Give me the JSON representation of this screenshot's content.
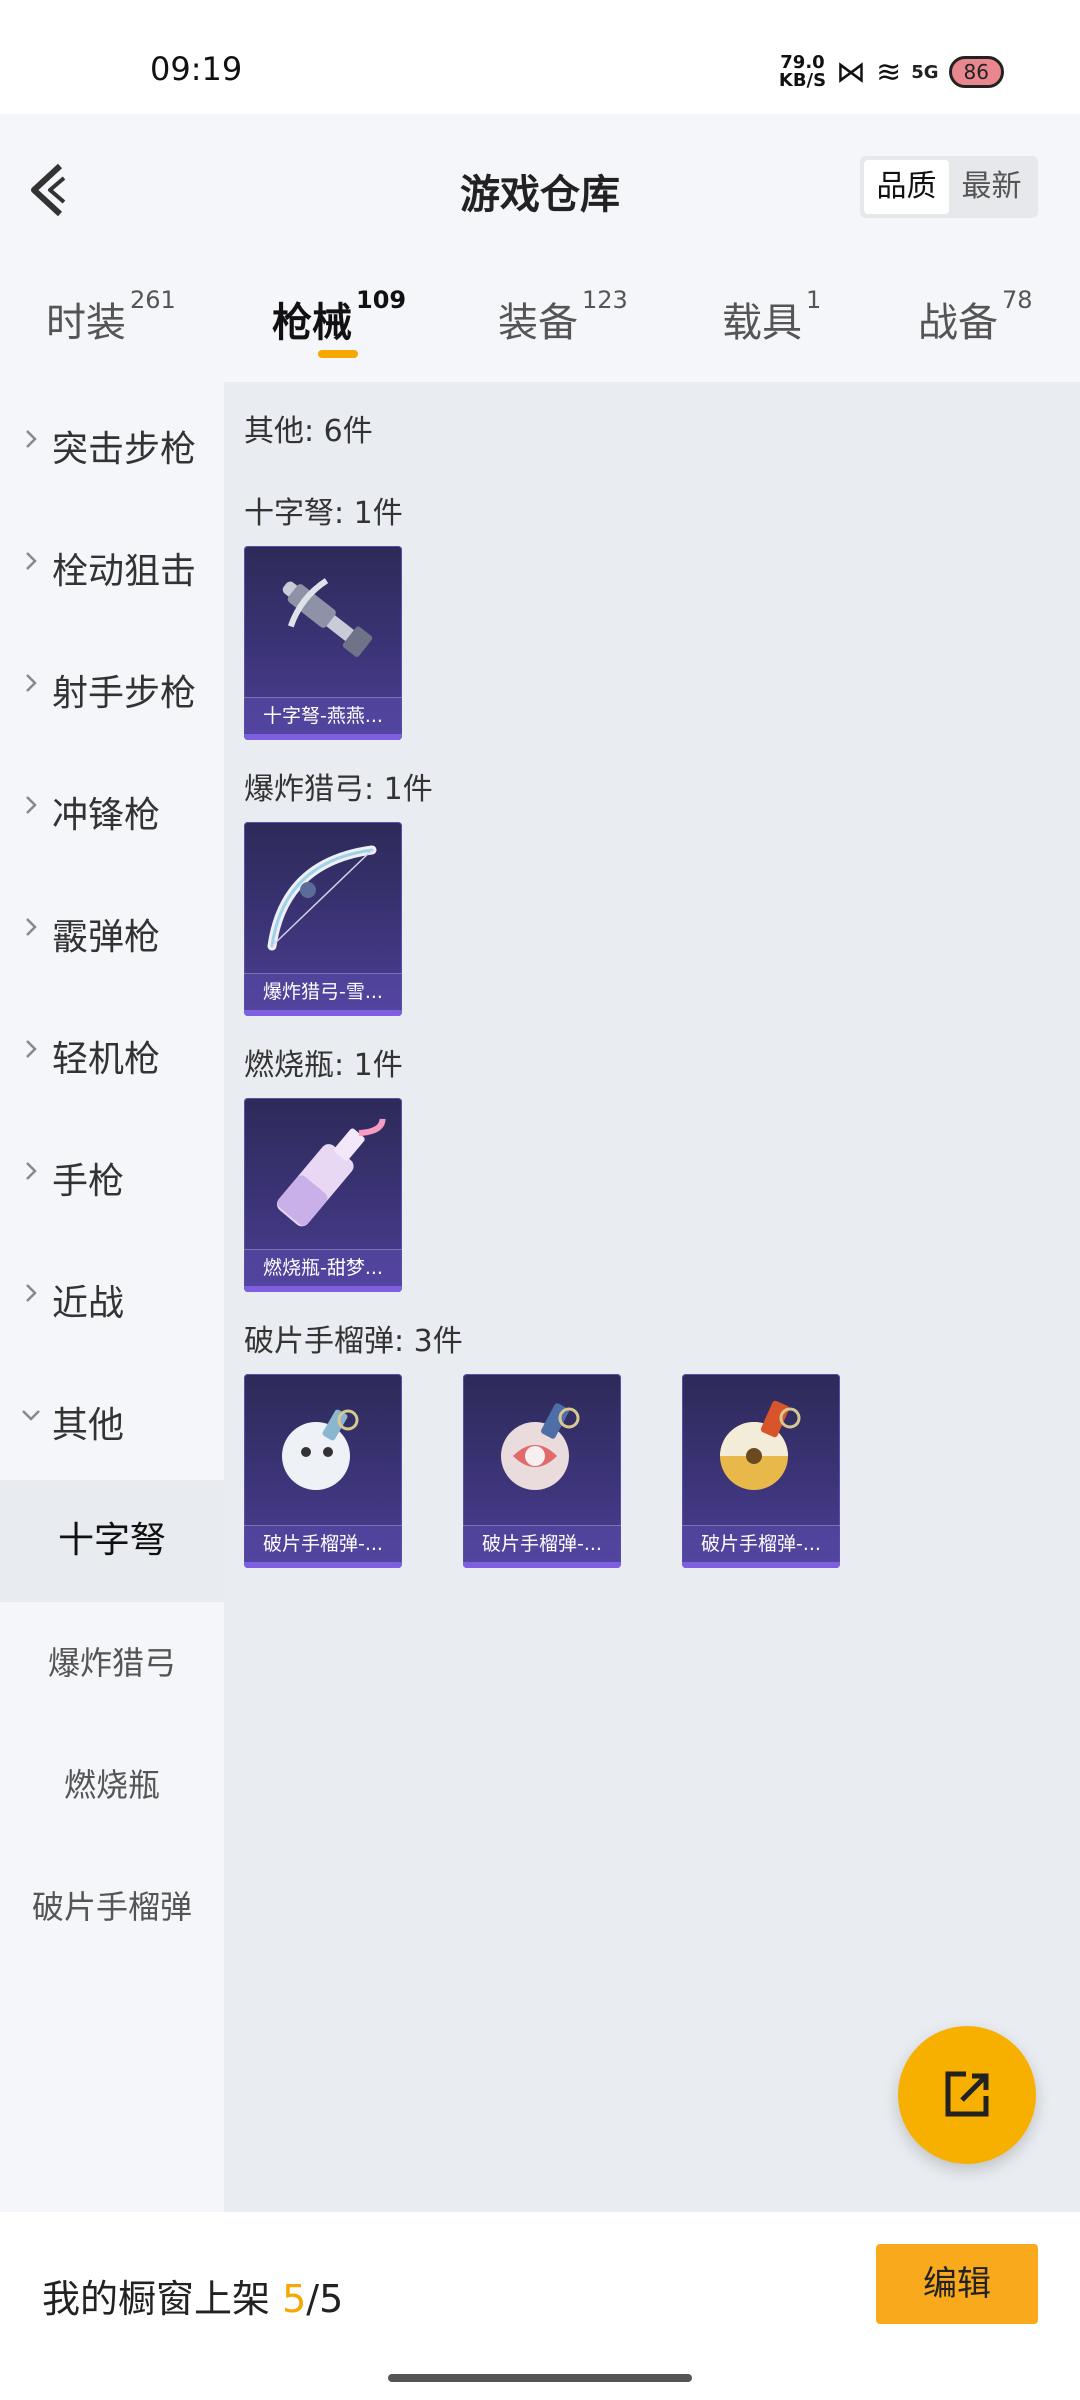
{
  "status_bar": {
    "time": "09:19",
    "speed_value": "79.0",
    "speed_unit": "KB/S",
    "network": "5G",
    "battery": "86",
    "status_icons": [
      "hd-icon",
      "bowtie-icon",
      "wifi-icon",
      "signal-5g-icon",
      "battery-icon"
    ]
  },
  "header": {
    "title": "游戏仓库",
    "sort_options": [
      "品质",
      "最新"
    ],
    "sort_selected": "品质"
  },
  "tabs": [
    {
      "label": "时装",
      "count": "261"
    },
    {
      "label": "枪械",
      "count": "109",
      "active": true
    },
    {
      "label": "装备",
      "count": "123"
    },
    {
      "label": "载具",
      "count": "1"
    },
    {
      "label": "战备",
      "count": "78"
    }
  ],
  "sidebar": {
    "categories": [
      "突击步枪",
      "栓动狙击",
      "射手步枪",
      "冲锋枪",
      "霰弹枪",
      "轻机枪",
      "手枪",
      "近战",
      "其他"
    ],
    "expanded": "其他",
    "subcategories": [
      "十字弩",
      "爆炸猎弓",
      "燃烧瓶",
      "破片手榴弹"
    ],
    "selected_sub": "十字弩"
  },
  "content": {
    "summary": "其他: 6件",
    "sections": [
      {
        "title": "十字弩: 1件",
        "items": [
          {
            "name": "十字弩-燕燕...",
            "icon": "crossbow-icon"
          }
        ]
      },
      {
        "title": "爆炸猎弓: 1件",
        "items": [
          {
            "name": "爆炸猎弓-雪...",
            "icon": "bow-icon"
          }
        ]
      },
      {
        "title": "燃烧瓶: 1件",
        "items": [
          {
            "name": "燃烧瓶-甜梦...",
            "icon": "molotov-icon"
          }
        ]
      },
      {
        "title": "破片手榴弹: 3件",
        "items": [
          {
            "name": "破片手榴弹-...",
            "icon": "grenade-icon"
          },
          {
            "name": "破片手榴弹-...",
            "icon": "grenade-icon"
          },
          {
            "name": "破片手榴弹-...",
            "icon": "grenade-icon"
          }
        ]
      }
    ]
  },
  "fab": {
    "icon": "share-external-icon"
  },
  "bottom": {
    "shelf_label": "我的橱窗上架",
    "shelf_current": "5",
    "shelf_total": "/5",
    "edit_label": "编辑"
  },
  "colors": {
    "accent": "#f7a800",
    "card": "#3c3478",
    "background": "#e9ecf0"
  }
}
